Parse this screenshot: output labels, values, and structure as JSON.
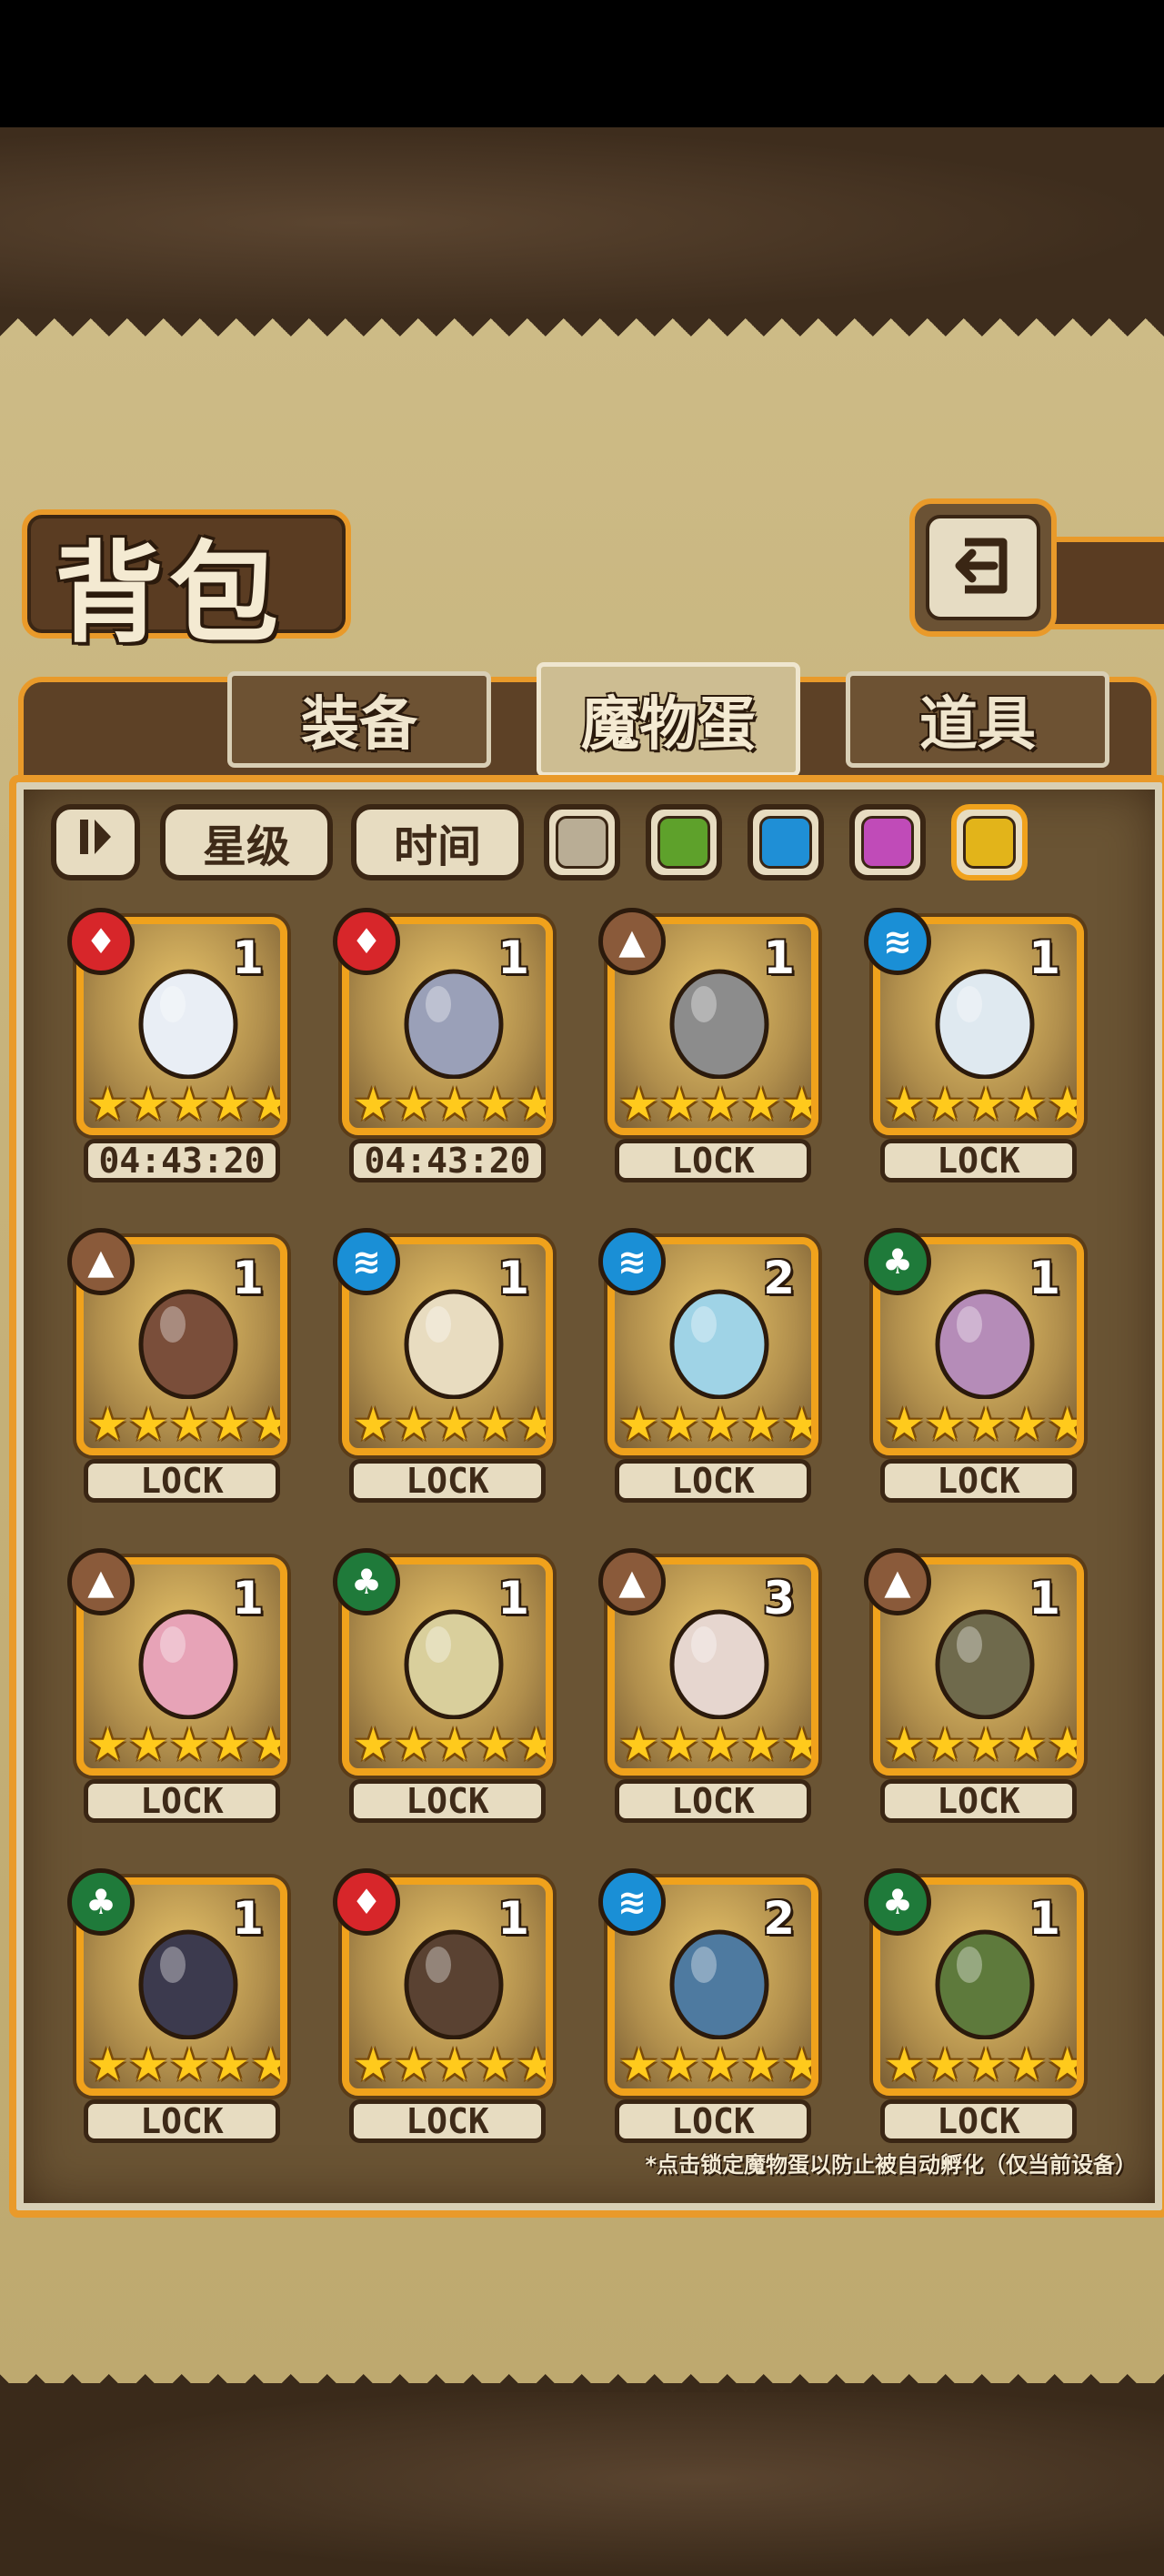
{
  "screen": {
    "title": "背包",
    "back_icon": "return-arrow-icon"
  },
  "tabs": [
    {
      "label": "装备",
      "active": false
    },
    {
      "label": "魔物蛋",
      "active": true
    },
    {
      "label": "道具",
      "active": false
    }
  ],
  "filters": {
    "sort_icon": "sort-toggle-icon",
    "star_label": "星级",
    "time_label": "时间",
    "colors": [
      "#b9ad95",
      "#5ea12b",
      "#1f8fd6",
      "#c04bb8",
      "#e2b41a"
    ]
  },
  "eggs": [
    {
      "element": "fire",
      "count": "1",
      "stars": 5,
      "status": "04:43:20",
      "art": "wizard-hat-egg-icon"
    },
    {
      "element": "fire",
      "count": "1",
      "stars": 5,
      "status": "04:43:20",
      "art": "spear-egg-icon"
    },
    {
      "element": "earth",
      "count": "1",
      "stars": 5,
      "status": "LOCK",
      "art": "cube-egg-icon"
    },
    {
      "element": "water",
      "count": "1",
      "stars": 5,
      "status": "LOCK",
      "art": "ribbon-egg-icon"
    },
    {
      "element": "earth",
      "count": "1",
      "stars": 5,
      "status": "LOCK",
      "art": "horned-egg-icon"
    },
    {
      "element": "water",
      "count": "1",
      "stars": 5,
      "status": "LOCK",
      "art": "angel-egg-icon"
    },
    {
      "element": "water",
      "count": "2",
      "stars": 5,
      "status": "LOCK",
      "art": "heart-egg-icon"
    },
    {
      "element": "wood",
      "count": "1",
      "stars": 5,
      "status": "LOCK",
      "art": "spotted-egg-icon"
    },
    {
      "element": "earth",
      "count": "1",
      "stars": 5,
      "status": "LOCK",
      "art": "bunny-egg-icon"
    },
    {
      "element": "wood",
      "count": "1",
      "stars": 5,
      "status": "LOCK",
      "art": "leaf-egg-icon"
    },
    {
      "element": "earth",
      "count": "3",
      "stars": 5,
      "status": "LOCK",
      "art": "flower-egg-icon"
    },
    {
      "element": "earth",
      "count": "1",
      "stars": 5,
      "status": "LOCK",
      "art": "rock-egg-icon"
    },
    {
      "element": "wood",
      "count": "1",
      "stars": 5,
      "status": "LOCK",
      "art": "dark-egg-icon"
    },
    {
      "element": "fire",
      "count": "1",
      "stars": 5,
      "status": "LOCK",
      "art": "pirate-egg-icon"
    },
    {
      "element": "water",
      "count": "2",
      "stars": 5,
      "status": "LOCK",
      "art": "shark-egg-icon"
    },
    {
      "element": "wood",
      "count": "1",
      "stars": 5,
      "status": "LOCK",
      "art": "feather-egg-icon"
    }
  ],
  "note": "*点击锁定魔物蛋以防止被自动孵化（仅当前设备）"
}
